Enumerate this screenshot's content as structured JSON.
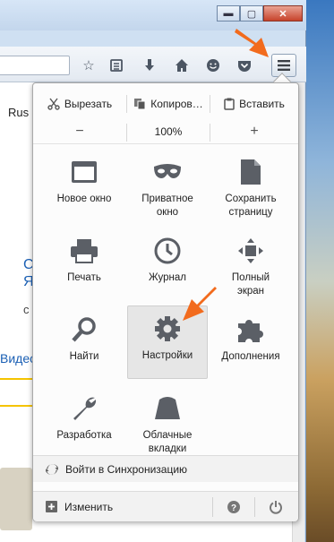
{
  "window": {
    "controls": {
      "minimize": "▬",
      "maximize": "▢",
      "close": "✕"
    }
  },
  "page": {
    "lang": "Rus",
    "left_link_1": "С",
    "left_link_2": "Я",
    "left_text": "с",
    "left_tab": "Видео"
  },
  "menu": {
    "edit": {
      "cut": "Вырезать",
      "copy": "Копиров…",
      "paste": "Вставить"
    },
    "zoom": {
      "minus": "−",
      "level": "100%",
      "plus": "+"
    },
    "items": [
      {
        "label": "Новое окно",
        "icon": "new-window-icon"
      },
      {
        "label": "Приватное окно",
        "icon": "private-mask-icon"
      },
      {
        "label": "Сохранить страницу",
        "icon": "save-page-icon"
      },
      {
        "label": "Печать",
        "icon": "printer-icon"
      },
      {
        "label": "Журнал",
        "icon": "history-clock-icon"
      },
      {
        "label": "Полный экран",
        "icon": "fullscreen-icon"
      },
      {
        "label": "Найти",
        "icon": "search-icon"
      },
      {
        "label": "Настройки",
        "icon": "gear-icon"
      },
      {
        "label": "Дополнения",
        "icon": "puzzle-icon"
      },
      {
        "label": "Разработка",
        "icon": "wrench-icon"
      },
      {
        "label": "Облачные вкладки",
        "icon": "cloud-tabs-icon"
      }
    ],
    "sync": "Войти в Синхронизацию",
    "customize": "Изменить"
  },
  "colors": {
    "arrow": "#f26b1d",
    "icon": "#5b5f66"
  }
}
